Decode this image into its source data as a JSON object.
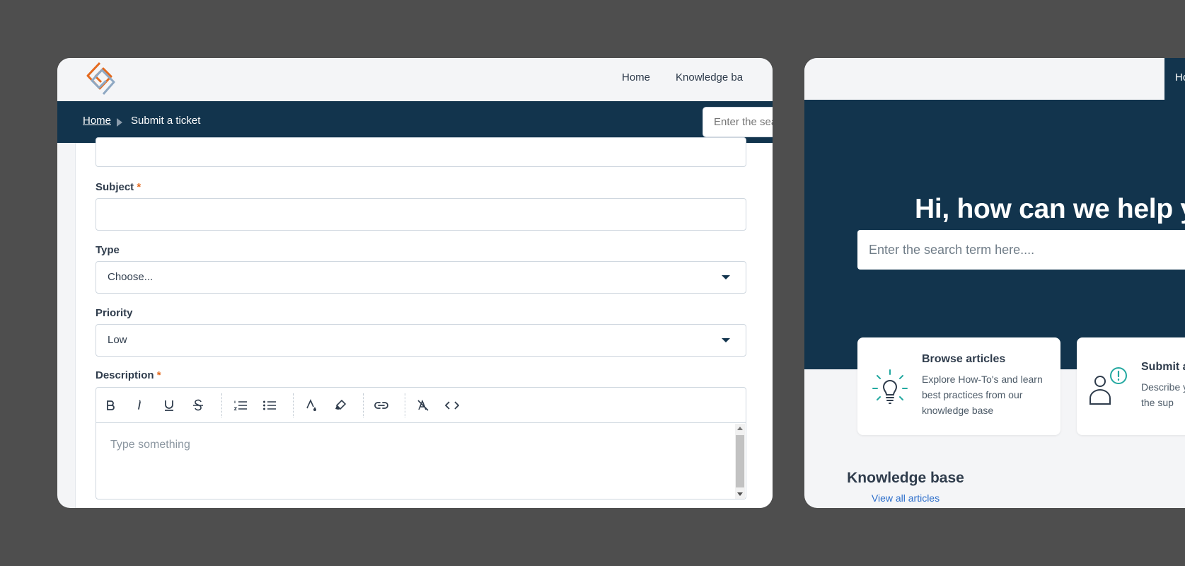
{
  "left": {
    "nav": {
      "home": "Home",
      "knowledge_base": "Knowledge ba"
    },
    "breadcrumb": {
      "home": "Home",
      "current": "Submit a ticket"
    },
    "header_search": {
      "placeholder": "Enter the search term here...."
    },
    "form": {
      "subject_label": "Subject",
      "type_label": "Type",
      "type_value": "Choose...",
      "priority_label": "Priority",
      "priority_value": "Low",
      "description_label": "Description",
      "required_mark": "*",
      "editor_placeholder": "Type something",
      "toolbar_icons": [
        "bold-icon",
        "italic-icon",
        "underline-icon",
        "strikethrough-icon",
        "numbered-list-icon",
        "bullet-list-icon",
        "text-color-icon",
        "highlight-icon",
        "link-icon",
        "clear-formatting-icon",
        "code-icon"
      ]
    }
  },
  "right": {
    "nav_active": "Ho",
    "hero_title": "Hi, how can we help yo",
    "search_placeholder": "Enter the search term here....",
    "tiles": [
      {
        "title": "Browse articles",
        "description": "Explore How-To's and learn best practices from our knowledge base",
        "icon": "lightbulb-icon"
      },
      {
        "title": "Submit a",
        "description": "Describe y up the sup",
        "icon": "person-alert-icon"
      }
    ],
    "kb_title": "Knowledge base",
    "kb_link": "View all articles"
  },
  "colors": {
    "brand_navy": "#12344d",
    "accent_orange": "#e46a1f",
    "teal_icon": "#23a8a0",
    "link_blue": "#2c6ecb",
    "backdrop": "#4e4e4e"
  }
}
